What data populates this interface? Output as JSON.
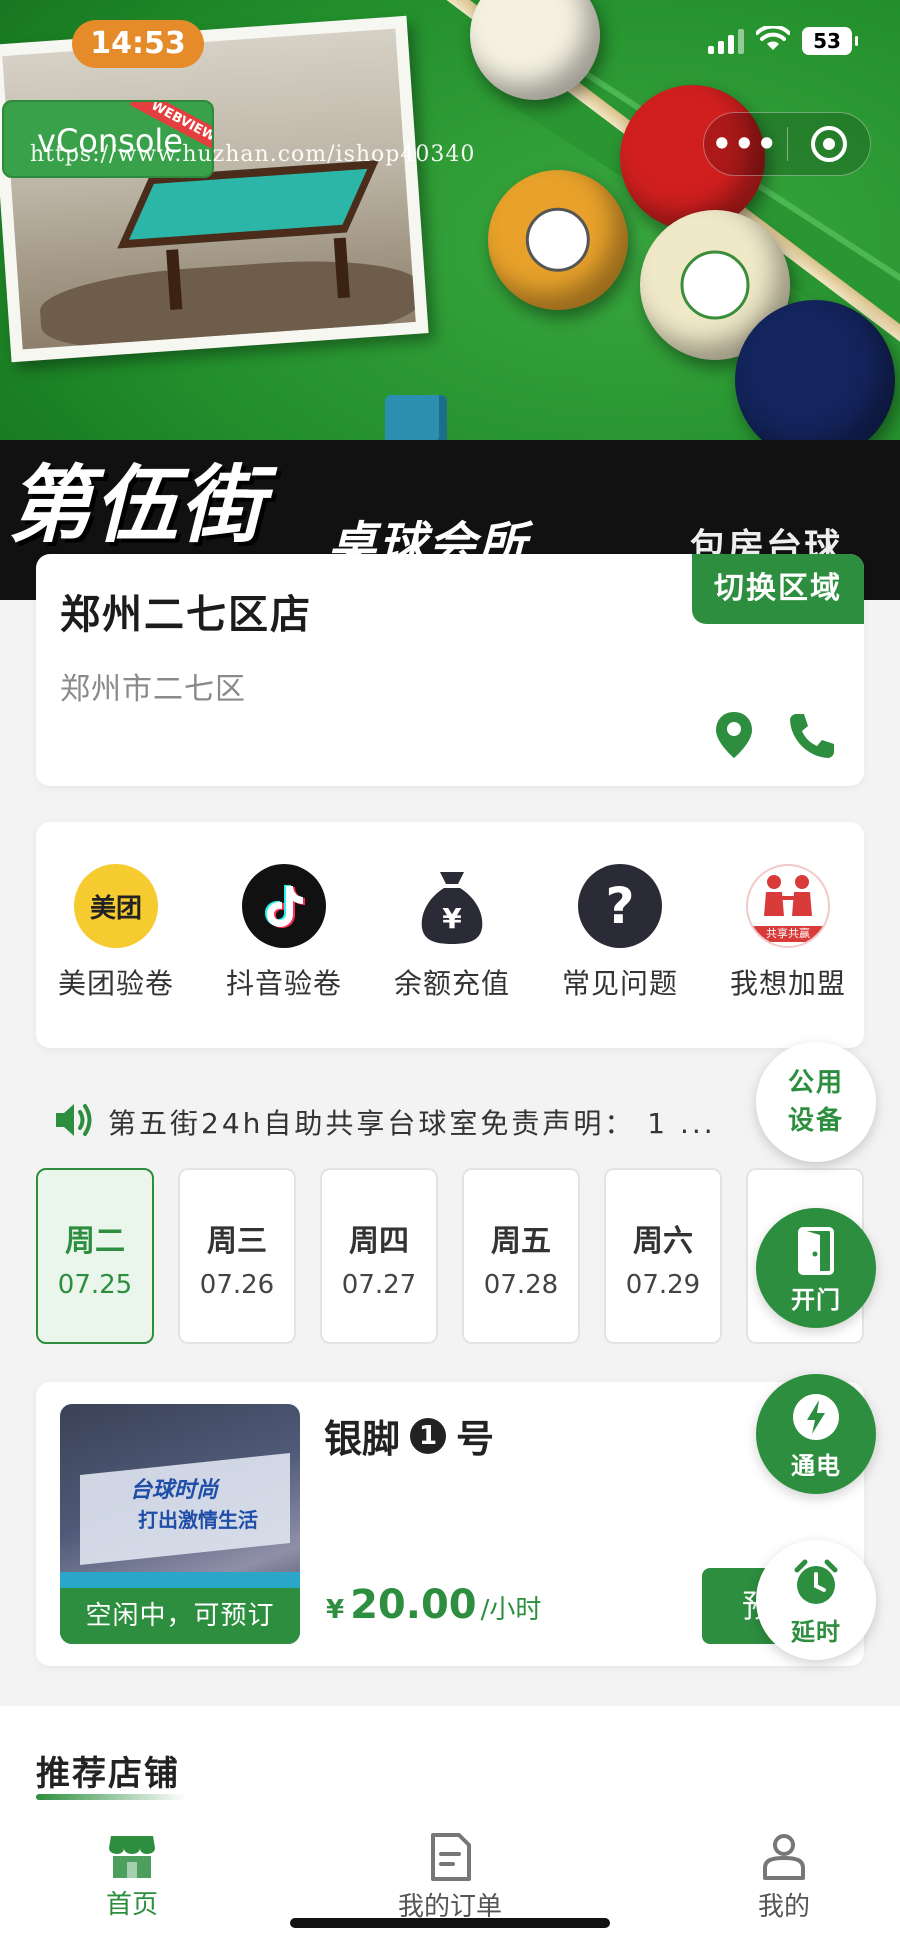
{
  "status_bar": {
    "time": "14:53",
    "battery": "53"
  },
  "vconsole": {
    "label": "vConsole",
    "ribbon": "WEBVIEW"
  },
  "watermark": "https://www.huzhan.com/ishop40340",
  "capsule": {
    "more": "•••"
  },
  "banner": {
    "brand_main": "第伍街",
    "brand_sub": "桌球会所",
    "brand_tag": "包房台球"
  },
  "store": {
    "name": "郑州二七区店",
    "address": "郑州市二七区",
    "switch_label": "切换区域"
  },
  "quick_menu": [
    {
      "label": "美团验卷",
      "icon_text": "美团",
      "icon": "meituan-icon",
      "color": "#f6cb2f"
    },
    {
      "label": "抖音验卷",
      "icon": "douyin-icon",
      "color": "#111111"
    },
    {
      "label": "余额充值",
      "icon_text": "¥",
      "icon": "money-bag-icon",
      "color": "#2b2b38"
    },
    {
      "label": "常见问题",
      "icon_text": "?",
      "icon": "question-icon",
      "color": "#2b2b38"
    },
    {
      "label": "我想加盟",
      "icon_text": "共享共赢",
      "icon": "join-icon",
      "color": "#d93a3a"
    }
  ],
  "notice": {
    "text": "第五街24h自助共享台球室免责声明： 1 ..."
  },
  "dates": [
    {
      "weekday": "周二",
      "date": "07.25",
      "active": true
    },
    {
      "weekday": "周三",
      "date": "07.26"
    },
    {
      "weekday": "周四",
      "date": "07.27"
    },
    {
      "weekday": "周五",
      "date": "07.28"
    },
    {
      "weekday": "周六",
      "date": "07.29"
    },
    {
      "weekday": "",
      "date": ""
    }
  ],
  "table": {
    "name_pre": "银脚",
    "number": "1",
    "name_post": "号",
    "status": "空闲中，可预订",
    "currency": "¥",
    "price": "20.00",
    "unit": "/小时",
    "book_label": "预",
    "photo_text_1": "台球时尚",
    "photo_text_2": "打出激情生活"
  },
  "floating": {
    "public_line1": "公用",
    "public_line2": "设备",
    "door": "开门",
    "power": "通电",
    "delay": "延时"
  },
  "recommend": {
    "title": "推荐店铺"
  },
  "tabbar": [
    {
      "label": "首页",
      "icon": "shop-icon",
      "active": true
    },
    {
      "label": "我的订单",
      "icon": "order-icon"
    },
    {
      "label": "我的",
      "icon": "user-icon"
    }
  ],
  "colors": {
    "brand_green": "#2d8e3f",
    "time_pill": "#e58b2a"
  }
}
